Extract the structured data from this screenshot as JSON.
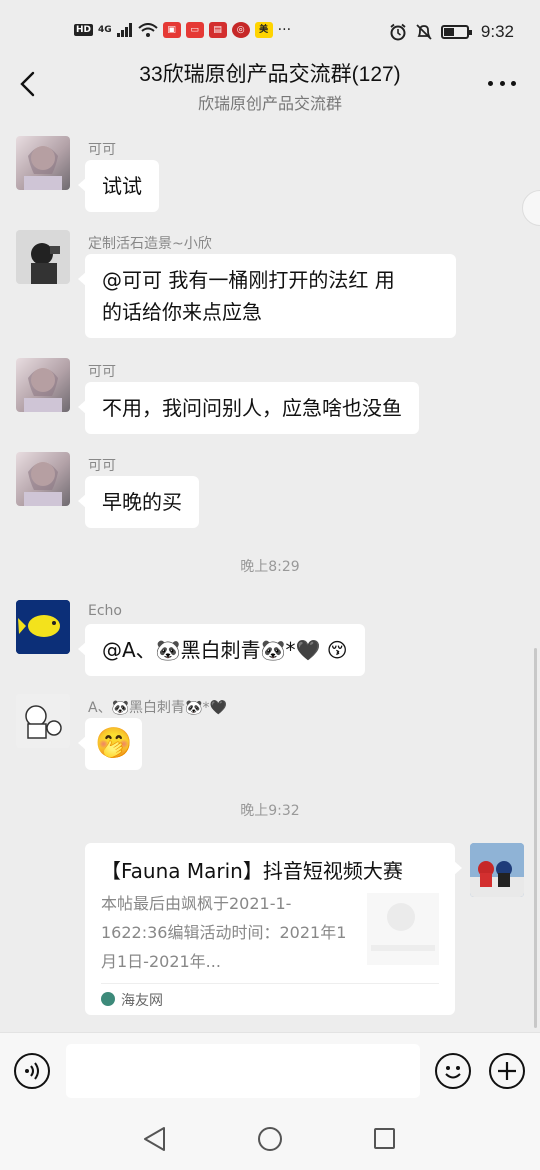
{
  "status_bar": {
    "left_icons": [
      "HD",
      "4G",
      "signal-icon",
      "wifi-icon",
      "app-icon-red",
      "app-icon-red2",
      "app-icon-news",
      "app-icon-bank",
      "app-icon-meituan",
      "more-dots"
    ],
    "hd_label": "HD",
    "network_label": "4G",
    "meituan_label": "美",
    "time": "9:32",
    "accent_red": "#e53935"
  },
  "header": {
    "title": "33欣瑞原创产品交流群(127)",
    "subtitle": "欣瑞原创产品交流群"
  },
  "messages": [
    {
      "sender": "可可",
      "text": "试试"
    },
    {
      "sender": "定制活石造景~小欣",
      "line1": "@可可  我有一桶刚打开的法红  用",
      "line2": "的话给你来点应急"
    },
    {
      "sender": "可可",
      "text": "不用，我问问别人，应急啥也没鱼"
    },
    {
      "sender": "可可",
      "text": "早晚的买"
    },
    {
      "timestamp": "晚上8:29"
    },
    {
      "sender": "Echo",
      "text": "@A、🐼黑白刺青🐼*🖤 😚"
    },
    {
      "sender": "A、🐼黑白刺青🐼*🖤",
      "sticker": "🤭"
    },
    {
      "timestamp": "晚上9:32"
    }
  ],
  "link_card": {
    "title": "【Fauna Marin】抖音短视频大赛",
    "desc": "本帖最后由飒枫于2021-1-1622:36编辑活动时间：2021年1月1日-2021年...",
    "source": "海友网"
  },
  "input": {
    "placeholder": ""
  }
}
